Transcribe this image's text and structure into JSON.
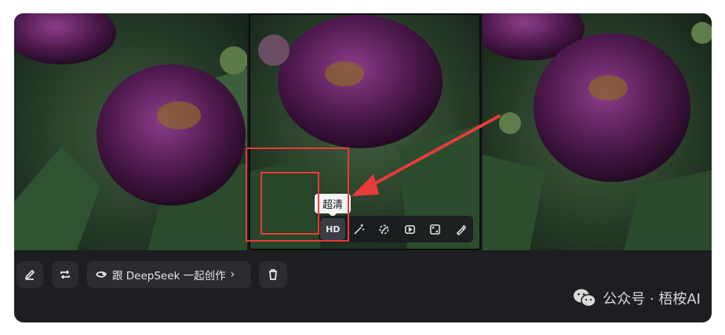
{
  "images": [
    {
      "name": "peony-image-1"
    },
    {
      "name": "peony-image-2"
    },
    {
      "name": "peony-image-3"
    }
  ],
  "tooltip": {
    "text": "超清"
  },
  "image_toolbar": {
    "hd_label": "HD",
    "tools": [
      "hd",
      "magic-wand-icon",
      "eraser-icon",
      "video-icon",
      "expand-icon",
      "brush-icon"
    ]
  },
  "actions": {
    "deepseek_label": "跟 DeepSeek 一起创作",
    "deepseek_chevron": "›"
  },
  "watermark": {
    "text": "公众号 · 梧桉AI"
  },
  "colors": {
    "highlight": "#e83b3b",
    "card_bg": "#1c1e22",
    "button_bg": "#2a2c31"
  }
}
